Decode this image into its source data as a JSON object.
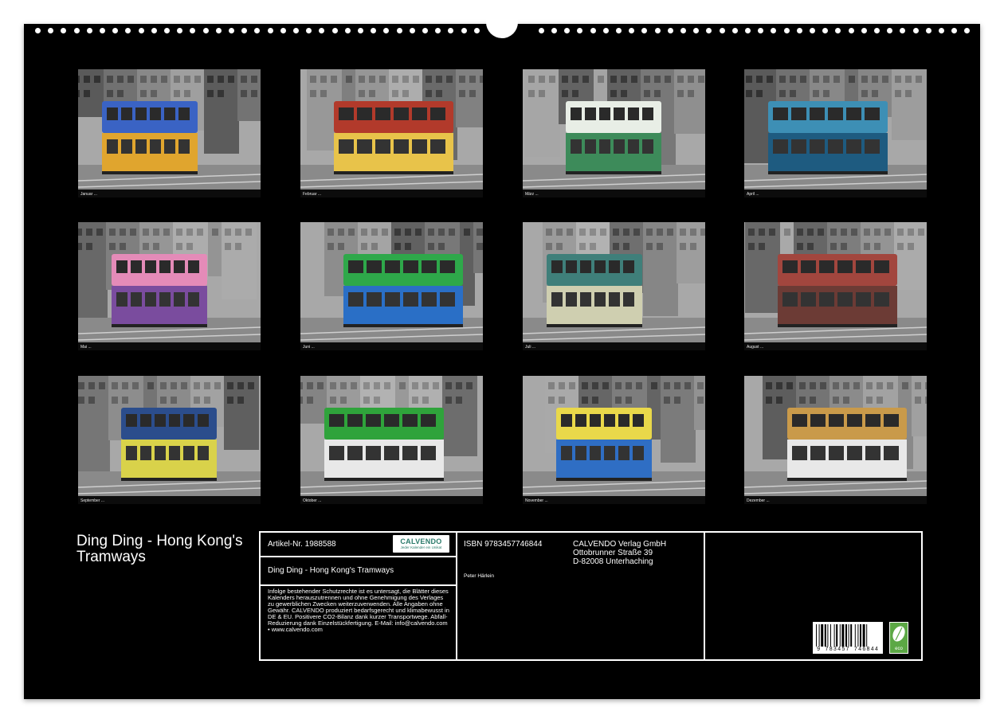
{
  "title": "Ding Ding - Hong Kong's Tramways",
  "months": [
    {
      "label": "Januar ...",
      "tram_color": "#3a63c4",
      "tram_color2": "#e0a52e"
    },
    {
      "label": "Februar ...",
      "tram_color": "#b23a2b",
      "tram_color2": "#e8c34a"
    },
    {
      "label": "März ...",
      "tram_color": "#e8eee6",
      "tram_color2": "#3d8b5a"
    },
    {
      "label": "April ...",
      "tram_color": "#3d8fb5",
      "tram_color2": "#1e5b80"
    },
    {
      "label": "Mai ...",
      "tram_color": "#e48bb8",
      "tram_color2": "#7a4c9e"
    },
    {
      "label": "Juni ...",
      "tram_color": "#2ea84a",
      "tram_color2": "#2a6fc6"
    },
    {
      "label": "Juli ...",
      "tram_color": "#3f7f7a",
      "tram_color2": "#cfcfb0"
    },
    {
      "label": "August ...",
      "tram_color": "#a2463e",
      "tram_color2": "#6c3b35"
    },
    {
      "label": "September ...",
      "tram_color": "#2b4d8c",
      "tram_color2": "#d9d24a"
    },
    {
      "label": "Oktober ...",
      "tram_color": "#2fa33b",
      "tram_color2": "#e8e8e8"
    },
    {
      "label": "November ...",
      "tram_color": "#e9d84a",
      "tram_color2": "#2f6ec4"
    },
    {
      "label": "Dezember ...",
      "tram_color": "#c99a4a",
      "tram_color2": "#e8e8e8"
    }
  ],
  "info": {
    "article_label": "Artikel-Nr. 1988588",
    "logo_word": "CALVENDO",
    "logo_sub": "Jeder Kalender ein Unikat",
    "product_title": "Ding Ding - Hong Kong's Tramways",
    "legal_text": "Infolge bestehender Schutzrechte ist es untersagt, die Blätter dieses Kalenders herauszutrennen und ohne Genehmigung des Verlages zu gewerblichen Zwecken weiterzuverwenden. Alle Angaben ohne Gewähr. CALVENDO produziert bedarfsgerecht und klimabewusst in DE & EU. Positivere CO2-Bilanz dank kurzer Transportwege. Abfall-Reduzierung dank Einzelstückfertigung. E-Mail: info@calvendo.com • www.calvendo.com",
    "isbn": "ISBN 9783457746844",
    "author": "Peter Härlein",
    "publisher_line1": "CALVENDO Verlag GmbH",
    "publisher_line2": "Ottobrunner Straße 39",
    "publisher_line3": "D-82008 Unterhaching",
    "barcode_number": "9 783457 746844",
    "eco_label": "eco"
  },
  "colors": {
    "background": "#000000",
    "text": "#ffffff",
    "eco": "#5ca845"
  }
}
